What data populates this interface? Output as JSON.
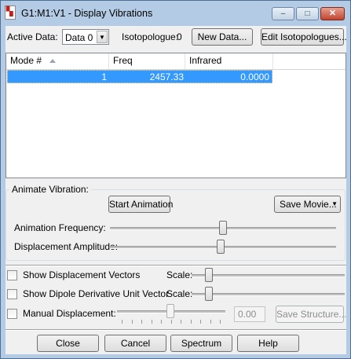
{
  "window": {
    "title": "G1:M1:V1 - Display Vibrations",
    "icon": "document-icon",
    "controls": {
      "minimize": "–",
      "maximize": "□",
      "close": "✕"
    }
  },
  "top": {
    "active_data_label": "Active Data:",
    "active_data_value": "Data 0",
    "isotopologue_label": "Isotopologue:",
    "isotopologue_value": "0",
    "new_data_button": "New Data...",
    "edit_isotopologues_button": "Edit Isotopologues..."
  },
  "table": {
    "columns": [
      "Mode #",
      "Freq",
      "Infrared"
    ],
    "rows": [
      {
        "mode": "1",
        "freq": "2457.33",
        "infrared": "0.0000"
      }
    ]
  },
  "animate": {
    "group_label": "Animate Vibration:",
    "start_button": "Start Animation",
    "save_movie_button": "Save Movie...",
    "frequency_label": "Animation Frequency:",
    "frequency_level": 0.5,
    "amplitude_label": "Displacement Amplitude:",
    "amplitude_level": 0.5
  },
  "options": {
    "show_displacement_vectors": "Show Displacement Vectors",
    "show_dipole_derivative": "Show Dipole Derivative Unit Vector",
    "manual_displacement": "Manual Displacement:",
    "scale_label": "Scale:",
    "manual_value": "0.00",
    "save_structure_button": "Save Structure..."
  },
  "footer": {
    "close": "Close",
    "cancel": "Cancel",
    "spectrum": "Spectrum",
    "help": "Help"
  }
}
